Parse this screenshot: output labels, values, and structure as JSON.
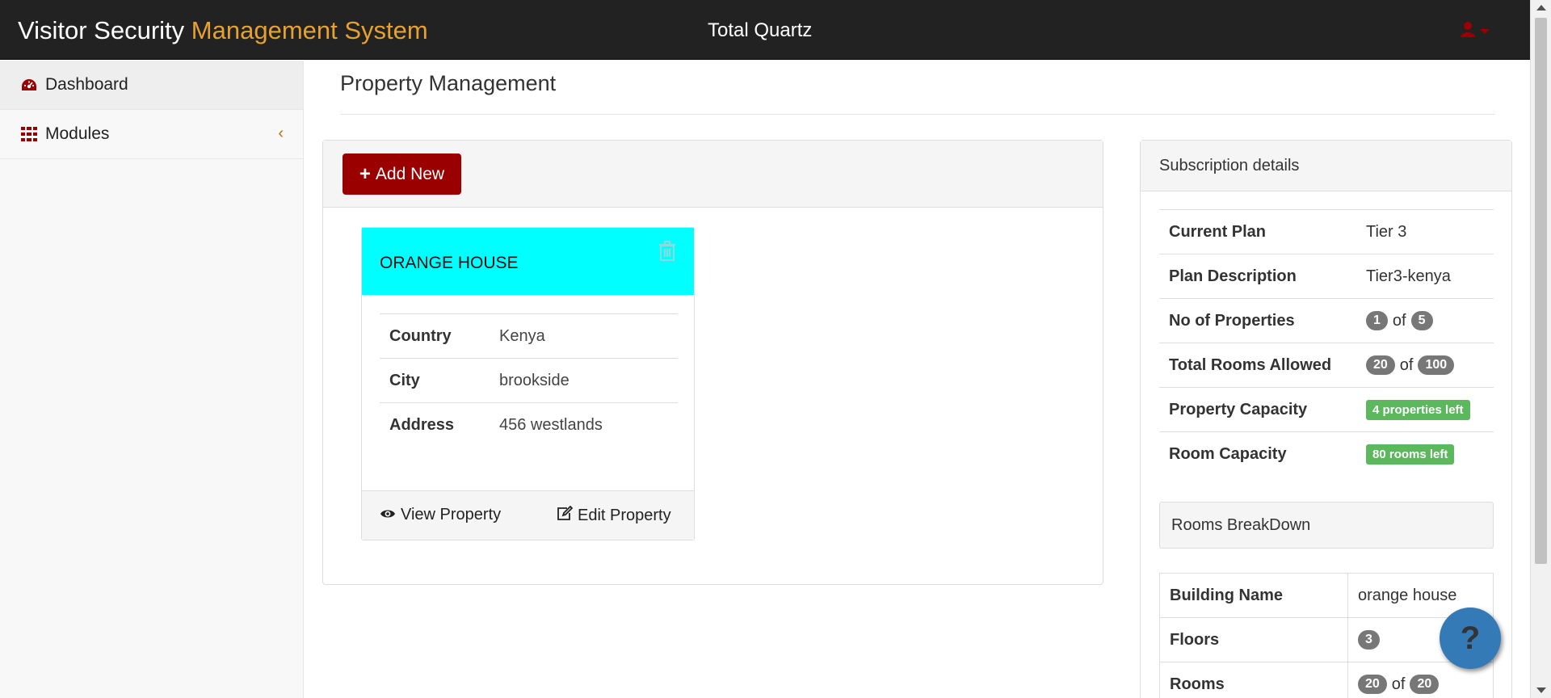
{
  "navbar": {
    "brand_primary": "Visitor Security",
    "brand_accent": "Management System",
    "tenant_name": "Total Quartz",
    "user_icon": "user-icon"
  },
  "sidebar": {
    "items": [
      {
        "label": "Dashboard",
        "icon": "dashboard-icon"
      },
      {
        "label": "Modules",
        "icon": "grid-icon",
        "chevron": "‹"
      }
    ]
  },
  "page": {
    "title": "Property Management"
  },
  "properties_panel": {
    "add_button_label": "Add New",
    "add_button_icon": "+",
    "cards": [
      {
        "name": "ORANGE HOUSE",
        "rows": [
          {
            "key": "Country",
            "value": "Kenya"
          },
          {
            "key": "City",
            "value": "brookside"
          },
          {
            "key": "Address",
            "value": "456 westlands"
          }
        ],
        "view_label": "View Property",
        "edit_label": "Edit Property"
      }
    ]
  },
  "subscription": {
    "heading": "Subscription details",
    "current_plan_label": "Current Plan",
    "current_plan_value": "Tier 3",
    "plan_description_label": "Plan Description",
    "plan_description_value": "Tier3-kenya",
    "properties_label": "No of Properties",
    "properties_used": "1",
    "properties_of": "of",
    "properties_total": "5",
    "rooms_allowed_label": "Total Rooms Allowed",
    "rooms_used": "20",
    "rooms_of": "of",
    "rooms_total": "100",
    "property_capacity_label": "Property Capacity",
    "property_capacity_value": "4 properties left",
    "room_capacity_label": "Room Capacity",
    "room_capacity_value": "80 rooms left"
  },
  "rooms_breakdown": {
    "heading": "Rooms BreakDown",
    "building_label": "Building Name",
    "building_value": "orange house",
    "floors_label": "Floors",
    "floors_value": "3",
    "rooms_label": "Rooms",
    "rooms_used": "20",
    "rooms_of": "of",
    "rooms_total": "20"
  },
  "help": {
    "glyph": "?"
  },
  "colors": {
    "navbar_bg": "#222222",
    "brand_accent": "#e7a12f",
    "primary_button": "#9b0000",
    "card_header": "#00ffff",
    "badge_gray": "#777777",
    "label_green": "#5cb85c",
    "help_button": "#337ab7"
  }
}
